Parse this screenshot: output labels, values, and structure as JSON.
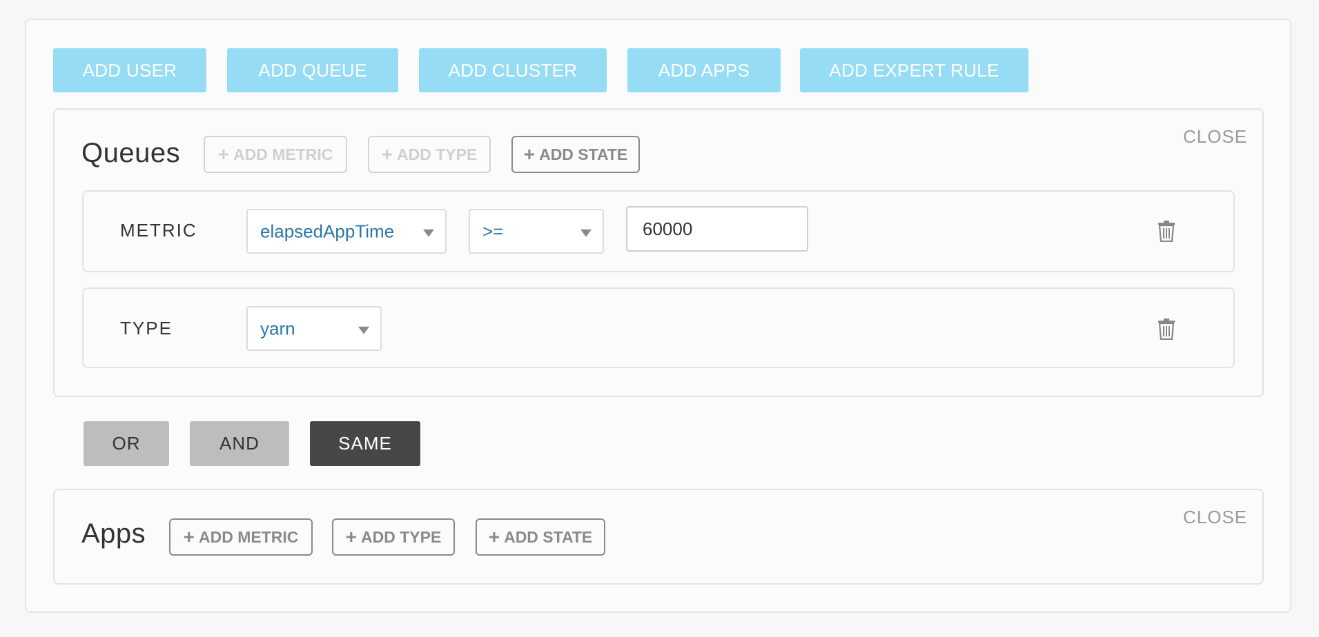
{
  "toolbar": {
    "add_user": "ADD USER",
    "add_queue": "ADD QUEUE",
    "add_cluster": "ADD CLUSTER",
    "add_apps": "ADD APPS",
    "add_expert_rule": "ADD EXPERT RULE"
  },
  "queues_panel": {
    "title": "Queues",
    "close": "CLOSE",
    "add_metric": "ADD METRIC",
    "add_type": "ADD TYPE",
    "add_state": "ADD STATE",
    "metric_row": {
      "label": "METRIC",
      "metric_select": "elapsedAppTime",
      "operator_select": ">=",
      "value": "60000"
    },
    "type_row": {
      "label": "TYPE",
      "type_select": "yarn"
    }
  },
  "logic": {
    "or": "OR",
    "and": "AND",
    "same": "SAME",
    "selected": "SAME"
  },
  "apps_panel": {
    "title": "Apps",
    "close": "CLOSE",
    "add_metric": "ADD METRIC",
    "add_type": "ADD TYPE",
    "add_state": "ADD STATE"
  },
  "colors": {
    "primary_button": "#97dcf5",
    "active_logic": "#474747",
    "select_text": "#2a77a8"
  },
  "icons": {
    "delete": "trash-icon",
    "add": "plus-icon",
    "dropdown": "caret-down-icon"
  }
}
